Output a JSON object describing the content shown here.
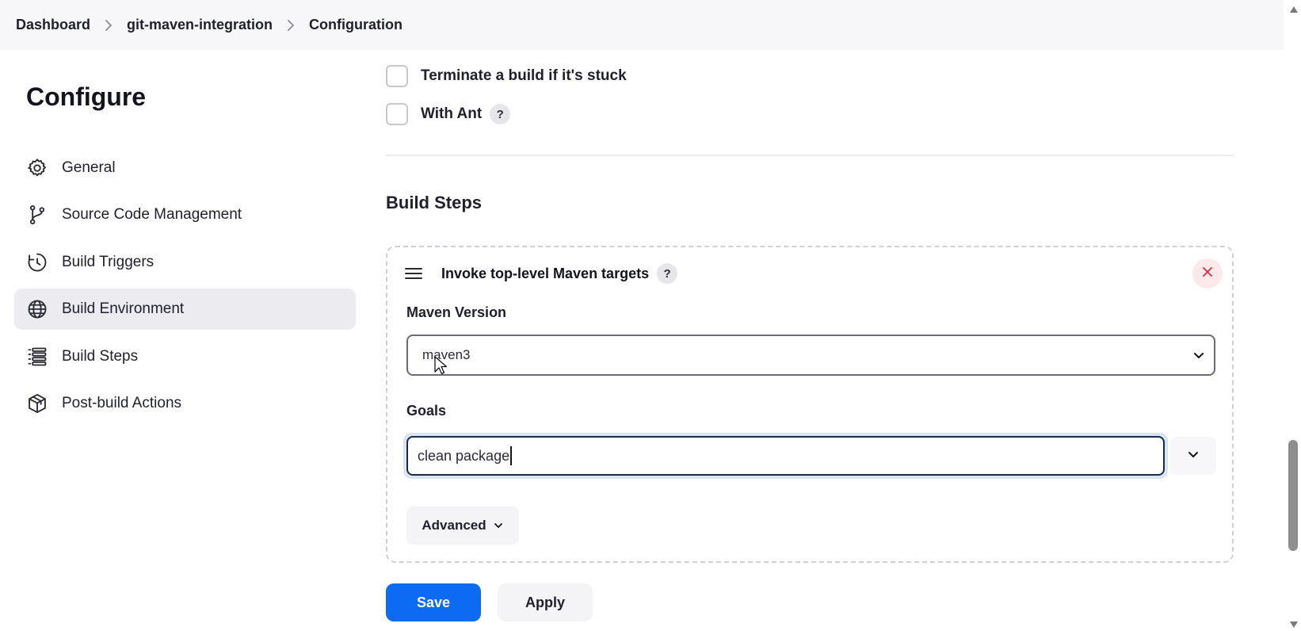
{
  "breadcrumb": {
    "items": [
      "Dashboard",
      "git-maven-integration",
      "Configuration"
    ]
  },
  "sidebar": {
    "title": "Configure",
    "items": [
      {
        "label": "General",
        "icon": "gear-icon"
      },
      {
        "label": "Source Code Management",
        "icon": "git-branch-icon"
      },
      {
        "label": "Build Triggers",
        "icon": "clock-icon"
      },
      {
        "label": "Build Environment",
        "icon": "globe-icon",
        "active": true
      },
      {
        "label": "Build Steps",
        "icon": "list-icon"
      },
      {
        "label": "Post-build Actions",
        "icon": "package-icon"
      }
    ]
  },
  "build_environment": {
    "options": [
      {
        "label": "Terminate a build if it's stuck",
        "checked": false
      },
      {
        "label": "With Ant",
        "checked": false,
        "help": "?"
      }
    ]
  },
  "build_steps": {
    "title": "Build Steps",
    "step": {
      "title": "Invoke top-level Maven targets",
      "help": "?",
      "maven_version_label": "Maven Version",
      "maven_version_value": "maven3",
      "goals_label": "Goals",
      "goals_value": "clean package",
      "advanced_label": "Advanced"
    }
  },
  "actions": {
    "save_label": "Save",
    "apply_label": "Apply"
  },
  "colors": {
    "primary": "#0b6bf2",
    "active_item_bg": "#ebebf0",
    "close_bg": "#fde8ea",
    "close_icon": "#d6303e"
  }
}
